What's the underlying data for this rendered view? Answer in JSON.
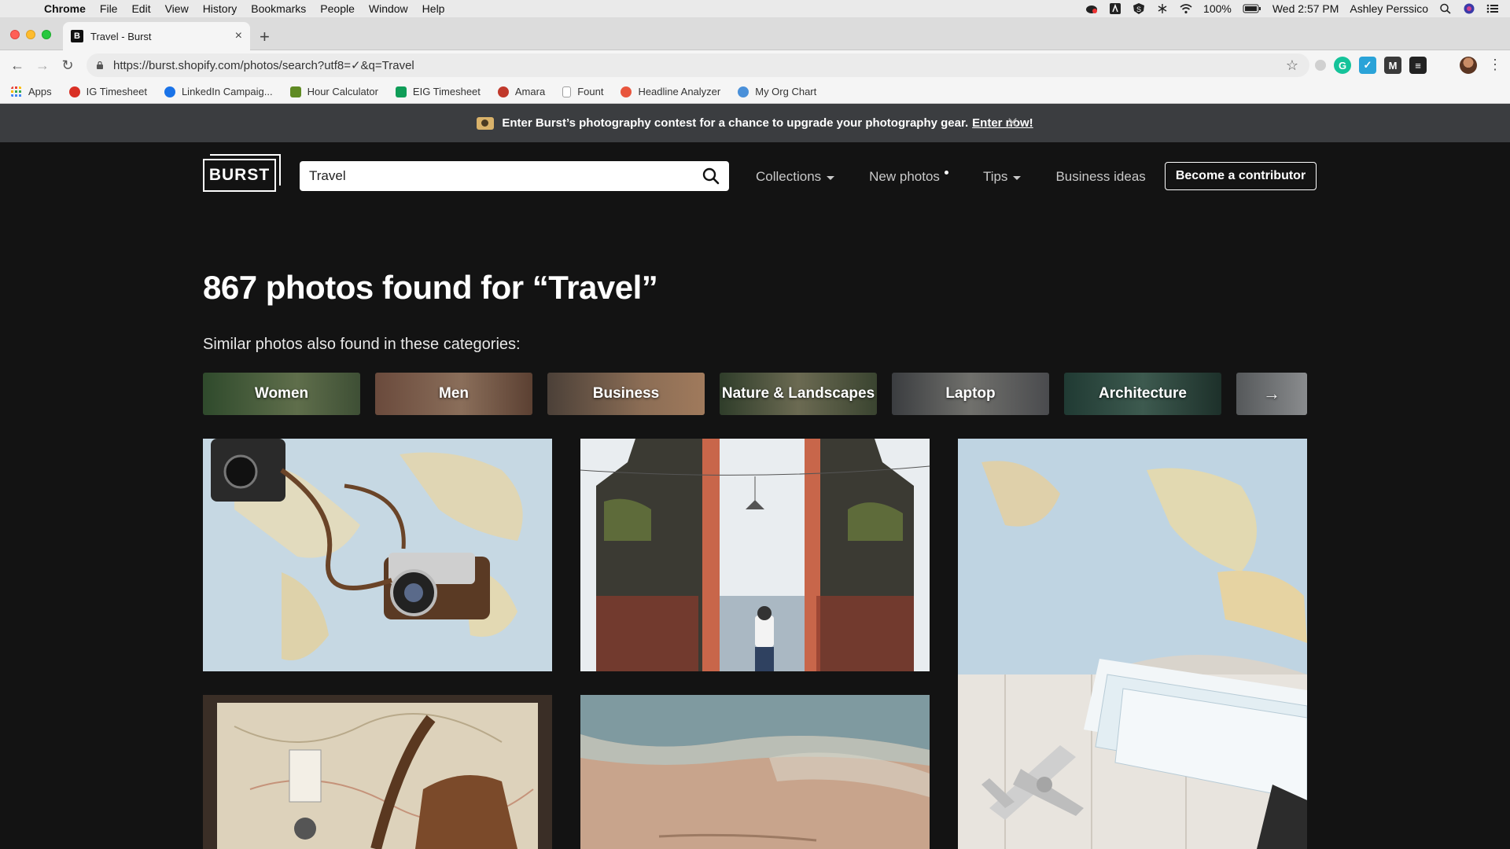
{
  "menubar": {
    "app": "Chrome",
    "items": [
      "File",
      "Edit",
      "View",
      "History",
      "Bookmarks",
      "People",
      "Window",
      "Help"
    ],
    "battery": "100%",
    "clock": "Wed 2:57 PM",
    "user": "Ashley Perssico"
  },
  "browser": {
    "tab_title": "Travel - Burst",
    "tab_favicon": "B",
    "url": "https://burst.shopify.com/photos/search?utf8=✓&q=Travel",
    "bookmarks": [
      {
        "label": "Apps",
        "icon": "apps-grid-icon",
        "color": "#e94235"
      },
      {
        "label": "IG Timesheet",
        "icon": "ig-timesheet-icon",
        "color": "#d93025"
      },
      {
        "label": "LinkedIn Campaig...",
        "icon": "linkedin-campaign-icon",
        "color": "#1a73e8"
      },
      {
        "label": "Hour Calculator",
        "icon": "hour-calculator-icon",
        "color": "#5f8a23"
      },
      {
        "label": "EIG Timesheet",
        "icon": "sheets-icon",
        "color": "#0f9d58"
      },
      {
        "label": "Amara",
        "icon": "amara-icon",
        "color": "#c0392b"
      },
      {
        "label": "Fount",
        "icon": "document-icon",
        "color": "#9e9e9e"
      },
      {
        "label": "Headline Analyzer",
        "icon": "headline-analyzer-icon",
        "color": "#e8553d"
      },
      {
        "label": "My Org Chart",
        "icon": "org-chart-icon",
        "color": "#4a90d9"
      }
    ],
    "extensions": [
      {
        "name": "extension-gray-icon",
        "color": "#d0d0d0",
        "glyph": ""
      },
      {
        "name": "grammarly-icon",
        "color": "#15c39a",
        "glyph": "G"
      },
      {
        "name": "extension-bird-icon",
        "color": "#2aa3d8",
        "glyph": "✓"
      },
      {
        "name": "extension-m-icon",
        "color": "#3a3a3a",
        "glyph": "M"
      },
      {
        "name": "buffer-icon",
        "color": "#222222",
        "glyph": "≡"
      }
    ]
  },
  "banner": {
    "text": "Enter Burst’s photography contest for a chance to upgrade your photography gear.",
    "link": "Enter now!"
  },
  "header": {
    "logo": "BURST",
    "search_value": "Travel",
    "nav": {
      "collections": "Collections",
      "new_photos": "New photos",
      "tips": "Tips",
      "business_ideas": "Business ideas"
    },
    "cta": "Become a contributor"
  },
  "results": {
    "heading": "867 photos found for “Travel”",
    "categories_label": "Similar photos also found in these categories:",
    "categories": [
      {
        "label": "Women",
        "colors": [
          "#2f4a2c",
          "#5f6e4b"
        ]
      },
      {
        "label": "Men",
        "colors": [
          "#6a4a3c",
          "#8a6e5a"
        ]
      },
      {
        "label": "Business",
        "colors": [
          "#4b4038",
          "#8b6d55"
        ]
      },
      {
        "label": "Nature & Landscapes",
        "colors": [
          "#2f3d2a",
          "#6b6a52"
        ]
      },
      {
        "label": "Laptop",
        "colors": [
          "#3b3d40",
          "#70706c"
        ]
      },
      {
        "label": "Architecture",
        "colors": [
          "#203a33",
          "#3d5a4f"
        ]
      }
    ]
  },
  "colors": {
    "page_bg": "#131313",
    "banner_bg": "#3b3d40",
    "nav_text": "#c9c9c9"
  }
}
